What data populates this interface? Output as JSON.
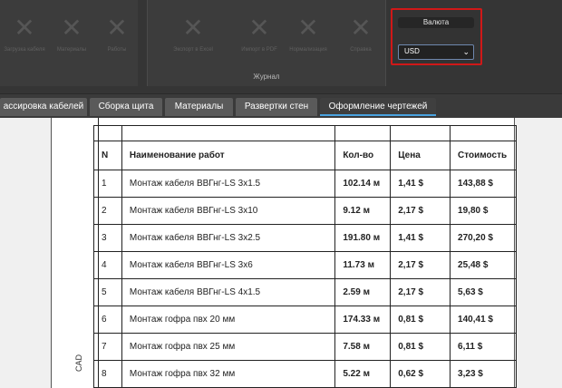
{
  "ribbon": {
    "left_tools": [
      {
        "label": "Загрузка кабеля"
      },
      {
        "label": "Материалы"
      },
      {
        "label": "Работы"
      }
    ],
    "journal_tools": [
      {
        "label": "Экспорт в Excel"
      },
      {
        "label": "Импорт в PDF"
      },
      {
        "label": "Нормализация"
      },
      {
        "label": "Справка"
      }
    ],
    "journal_caption": "Журнал",
    "currency": {
      "title": "Валюта",
      "selected": "USD"
    }
  },
  "tabs": [
    {
      "label": "ассировка кабелей"
    },
    {
      "label": "Сборка щита"
    },
    {
      "label": "Материалы"
    },
    {
      "label": "Развертки стен"
    },
    {
      "label": "Оформление чертежей",
      "active": true
    }
  ],
  "sheet": {
    "stamp": "CAD"
  },
  "table": {
    "headers": [
      "N",
      "Наименование работ",
      "Кол-во",
      "Цена",
      "Стоимость"
    ],
    "rows": [
      [
        "1",
        "Монтаж кабеля ВВГнг-LS 3x1.5",
        "102.14 м",
        "1,41 $",
        "143,88 $"
      ],
      [
        "2",
        "Монтаж кабеля ВВГнг-LS 3x10",
        "9.12 м",
        "2,17 $",
        "19,80 $"
      ],
      [
        "3",
        "Монтаж кабеля ВВГнг-LS 3x2.5",
        "191.80 м",
        "1,41 $",
        "270,20 $"
      ],
      [
        "4",
        "Монтаж кабеля ВВГнг-LS 3x6",
        "11.73 м",
        "2,17 $",
        "25,48 $"
      ],
      [
        "5",
        "Монтаж кабеля ВВГнг-LS 4x1.5",
        "2.59 м",
        "2,17 $",
        "5,63 $"
      ],
      [
        "6",
        "Монтаж гофра пвх 20 мм",
        "174.33 м",
        "0,81 $",
        "140,41 $"
      ],
      [
        "7",
        "Монтаж гофра пвх 25 мм",
        "7.58 м",
        "0,81 $",
        "6,11 $"
      ],
      [
        "8",
        "Монтаж гофра пвх 32 мм",
        "5.22 м",
        "0,62 $",
        "3,23 $"
      ]
    ]
  }
}
